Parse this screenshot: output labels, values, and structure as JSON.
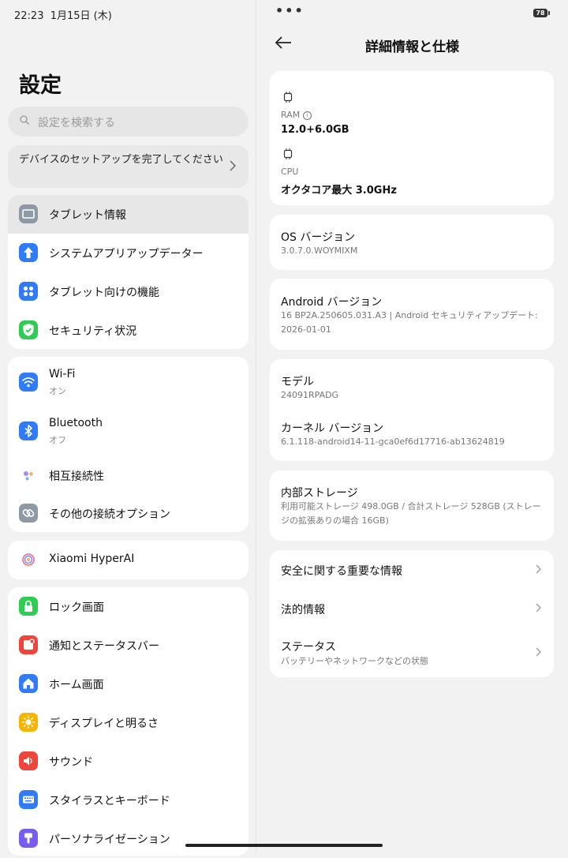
{
  "status": {
    "time": "22:23",
    "date": "1月15日 (木)",
    "battery": "78"
  },
  "left": {
    "title": "設定",
    "search_placeholder": "設定を検索する",
    "setup_banner": "デバイスのセットアップを完了してください",
    "groups": [
      [
        {
          "label": "タブレット情報",
          "icon": "tablet-icon",
          "color": "#8e99a6",
          "selected": true
        },
        {
          "label": "システムアプリアップデーター",
          "icon": "arrow-up-icon",
          "color": "#2f7cf6"
        },
        {
          "label": "タブレット向けの機能",
          "icon": "grid-dots-icon",
          "color": "#2f7cf6"
        },
        {
          "label": "セキュリティ状況",
          "icon": "shield-check-icon",
          "color": "#2ecc52"
        }
      ],
      [
        {
          "label": "Wi-Fi",
          "sub": "オン",
          "icon": "wifi-icon",
          "color": "#2f7cf6"
        },
        {
          "label": "Bluetooth",
          "sub": "オフ",
          "icon": "bluetooth-icon",
          "color": "#2f7cf6"
        },
        {
          "label": "相互接続性",
          "icon": "interconnect-dots-icon",
          "color": "#ffffff"
        },
        {
          "label": "その他の接続オプション",
          "icon": "link-icon",
          "color": "#8e99a6"
        }
      ],
      [
        {
          "label": "Xiaomi HyperAI",
          "icon": "hyperai-icon",
          "color": "#ffffff"
        }
      ],
      [
        {
          "label": "ロック画面",
          "icon": "lock-icon",
          "color": "#2ecc52"
        },
        {
          "label": "通知とステータスバー",
          "icon": "notification-icon",
          "color": "#f0453a"
        },
        {
          "label": "ホーム画面",
          "icon": "home-icon",
          "color": "#2f7cf6"
        },
        {
          "label": "ディスプレイと明るさ",
          "icon": "sun-icon",
          "color": "#f7b500"
        },
        {
          "label": "サウンド",
          "icon": "speaker-icon",
          "color": "#f0453a"
        },
        {
          "label": "スタイラスとキーボード",
          "icon": "keyboard-icon",
          "color": "#2f7cf6"
        },
        {
          "label": "パーソナライゼーション",
          "icon": "brush-icon",
          "color": "#7b5cf0"
        }
      ]
    ]
  },
  "right": {
    "title": "詳細情報と仕様",
    "ram_label": "RAM",
    "ram_value": "12.0+6.0GB",
    "cpu_label": "CPU",
    "cpu_value": "オクタコア最大 3.0GHz",
    "os_label": "OS バージョン",
    "os_value": "3.0.7.0.WOYMIXM",
    "android_label": "Android バージョン",
    "android_value": "16 BP2A.250605.031.A3 | Android セキュリティアップデート: 2026-01-01",
    "model_label": "モデル",
    "model_value": "24091RPADG",
    "kernel_label": "カーネル バージョン",
    "kernel_value": "6.1.118-android14-11-gca0ef6d17716-ab13624819",
    "storage_label": "内部ストレージ",
    "storage_value": "利用可能ストレージ 498.0GB / 合計ストレージ 528GB (ストレージの拡張ありの場合 16GB)",
    "safety_label": "安全に関する重要な情報",
    "legal_label": "法的情報",
    "status_label": "ステータス",
    "status_sub": "バッテリーやネットワークなどの状態"
  }
}
